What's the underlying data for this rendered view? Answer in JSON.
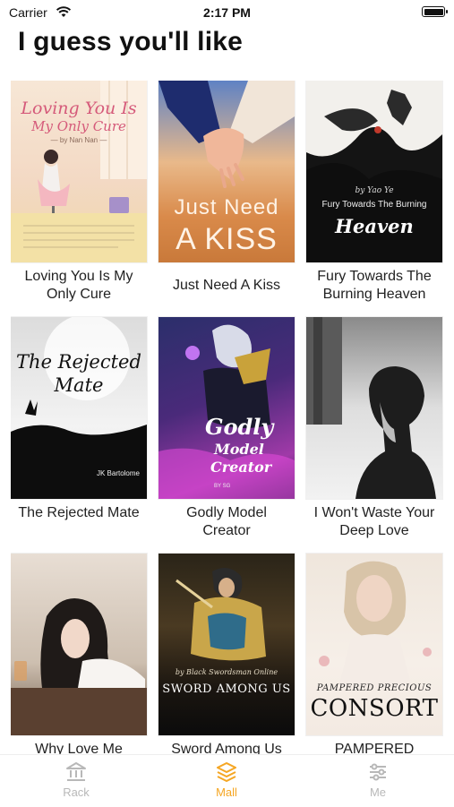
{
  "status_bar": {
    "carrier": "Carrier",
    "time": "2:17 PM"
  },
  "page": {
    "title": "I guess you'll like"
  },
  "books": [
    {
      "title": "Loving You Is My Only Cure",
      "cover_lines": [
        "Loving You Is",
        "My Only Cure",
        "— by Nan Nan —"
      ]
    },
    {
      "title": "Just Need A Kiss",
      "cover_lines": [
        "Just Need",
        "A KISS"
      ]
    },
    {
      "title": "Fury Towards The Burning Heaven",
      "cover_lines": [
        "by Yao Ye",
        "Fury Towards The Burning",
        "Heaven"
      ]
    },
    {
      "title": "The Rejected Mate",
      "cover_lines": [
        "The Rejected",
        "Mate",
        "JK Bartolome"
      ]
    },
    {
      "title": "Godly Model Creator",
      "cover_lines": [
        "Godly",
        "Model",
        "Creator",
        "BY SG"
      ]
    },
    {
      "title": "I Won't Waste Your Deep Love",
      "cover_lines": []
    },
    {
      "title": "Why Love Me",
      "cover_lines": []
    },
    {
      "title": "Sword Among Us",
      "cover_lines": [
        "by Black Swordsman Online",
        "SWORD AMONG US"
      ]
    },
    {
      "title": "PAMPERED",
      "cover_lines": [
        "PAMPERED PRECIOUS",
        "CONSORT"
      ]
    }
  ],
  "tabs": [
    {
      "label": "Rack",
      "icon": "bank-icon",
      "active": false
    },
    {
      "label": "Mall",
      "icon": "layers-icon",
      "active": true
    },
    {
      "label": "Me",
      "icon": "sliders-icon",
      "active": false
    }
  ],
  "colors": {
    "accent": "#f5a623",
    "inactive": "#b8b8b8"
  }
}
